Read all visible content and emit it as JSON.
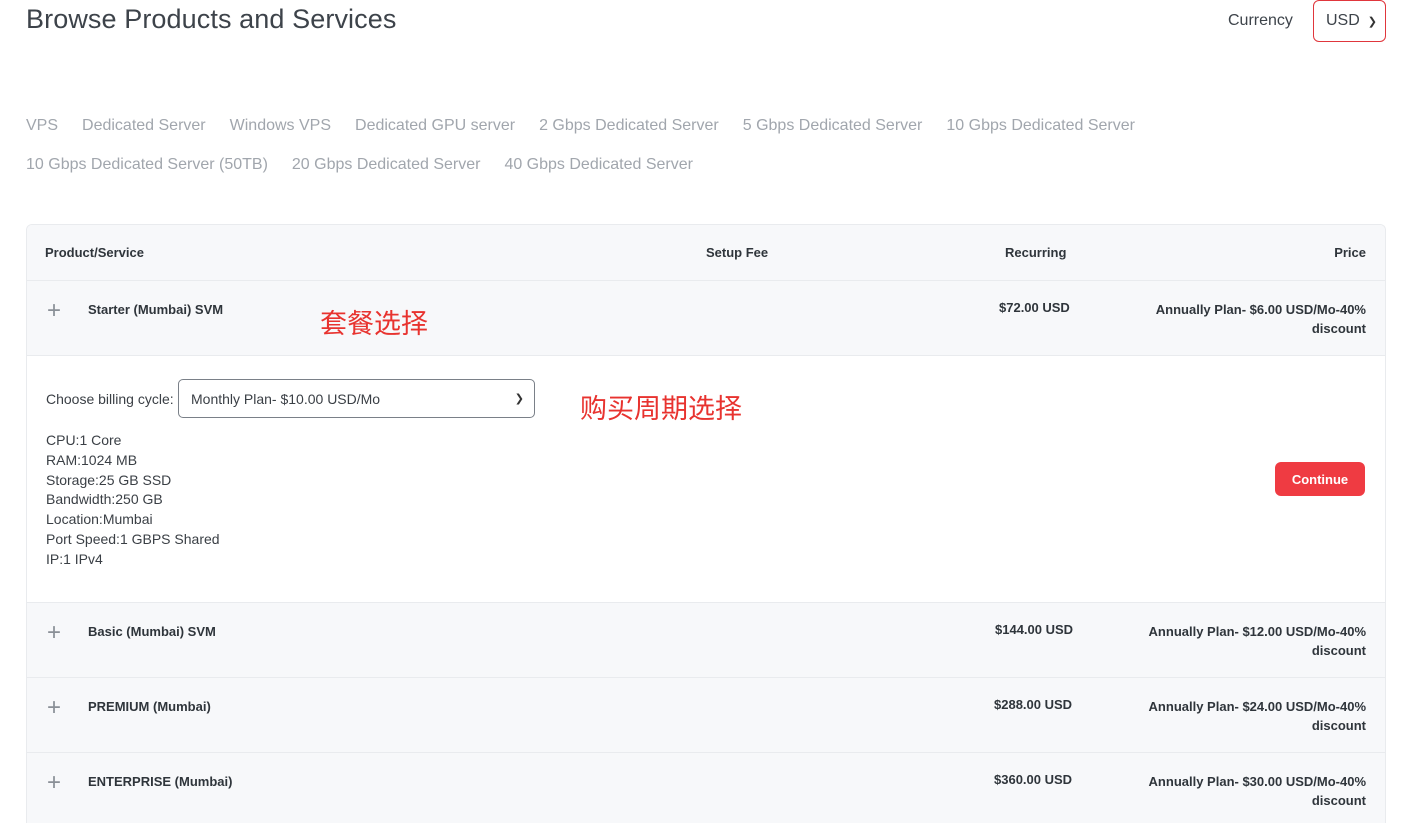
{
  "header": {
    "title": "Browse Products and Services",
    "currency_label": "Currency",
    "currency_value": "USD"
  },
  "categories": {
    "row1": [
      "VPS",
      "Dedicated Server",
      "Windows VPS",
      "Dedicated GPU server",
      "2 Gbps Dedicated Server",
      "5 Gbps Dedicated Server",
      "10 Gbps Dedicated Server"
    ],
    "row2": [
      "10 Gbps Dedicated Server (50TB)",
      "20 Gbps Dedicated Server",
      "40 Gbps Dedicated Server"
    ]
  },
  "table": {
    "headers": {
      "product": "Product/Service",
      "setup_fee": "Setup Fee",
      "recurring": "Recurring",
      "price": "Price"
    },
    "products": [
      {
        "name": "Starter (Mumbai) SVM",
        "recurring": "$72.00 USD",
        "price": "Annually Plan- $6.00 USD/Mo-40% discount"
      },
      {
        "name": "Basic (Mumbai) SVM",
        "recurring": "$144.00 USD",
        "price": "Annually Plan- $12.00 USD/Mo-40% discount"
      },
      {
        "name": "PREMIUM (Mumbai)",
        "recurring": "$288.00 USD",
        "price": "Annually Plan- $24.00 USD/Mo-40% discount"
      },
      {
        "name": "ENTERPRISE (Mumbai)",
        "recurring": "$360.00 USD",
        "price": "Annually Plan- $30.00 USD/Mo-40% discount"
      }
    ],
    "expanded": {
      "billing_label": "Choose billing cycle:",
      "billing_value": "Monthly Plan- $10.00 USD/Mo",
      "specs": [
        "CPU:1 Core",
        "RAM:1024 MB",
        "Storage:25 GB SSD",
        "Bandwidth:250 GB",
        "Location:Mumbai",
        "Port Speed:1 GBPS Shared",
        "IP:1 IPv4"
      ],
      "continue_label": "Continue"
    }
  },
  "annotations": {
    "plan_select": "套餐选择",
    "cycle_select": "购买周期选择"
  },
  "icons": {
    "expand": "plus-icon",
    "dropdown": "chevron-down-icon"
  },
  "colors": {
    "accent": "#ef3b42",
    "annotation": "#e8332f",
    "category_link": "#a1a6ad"
  }
}
